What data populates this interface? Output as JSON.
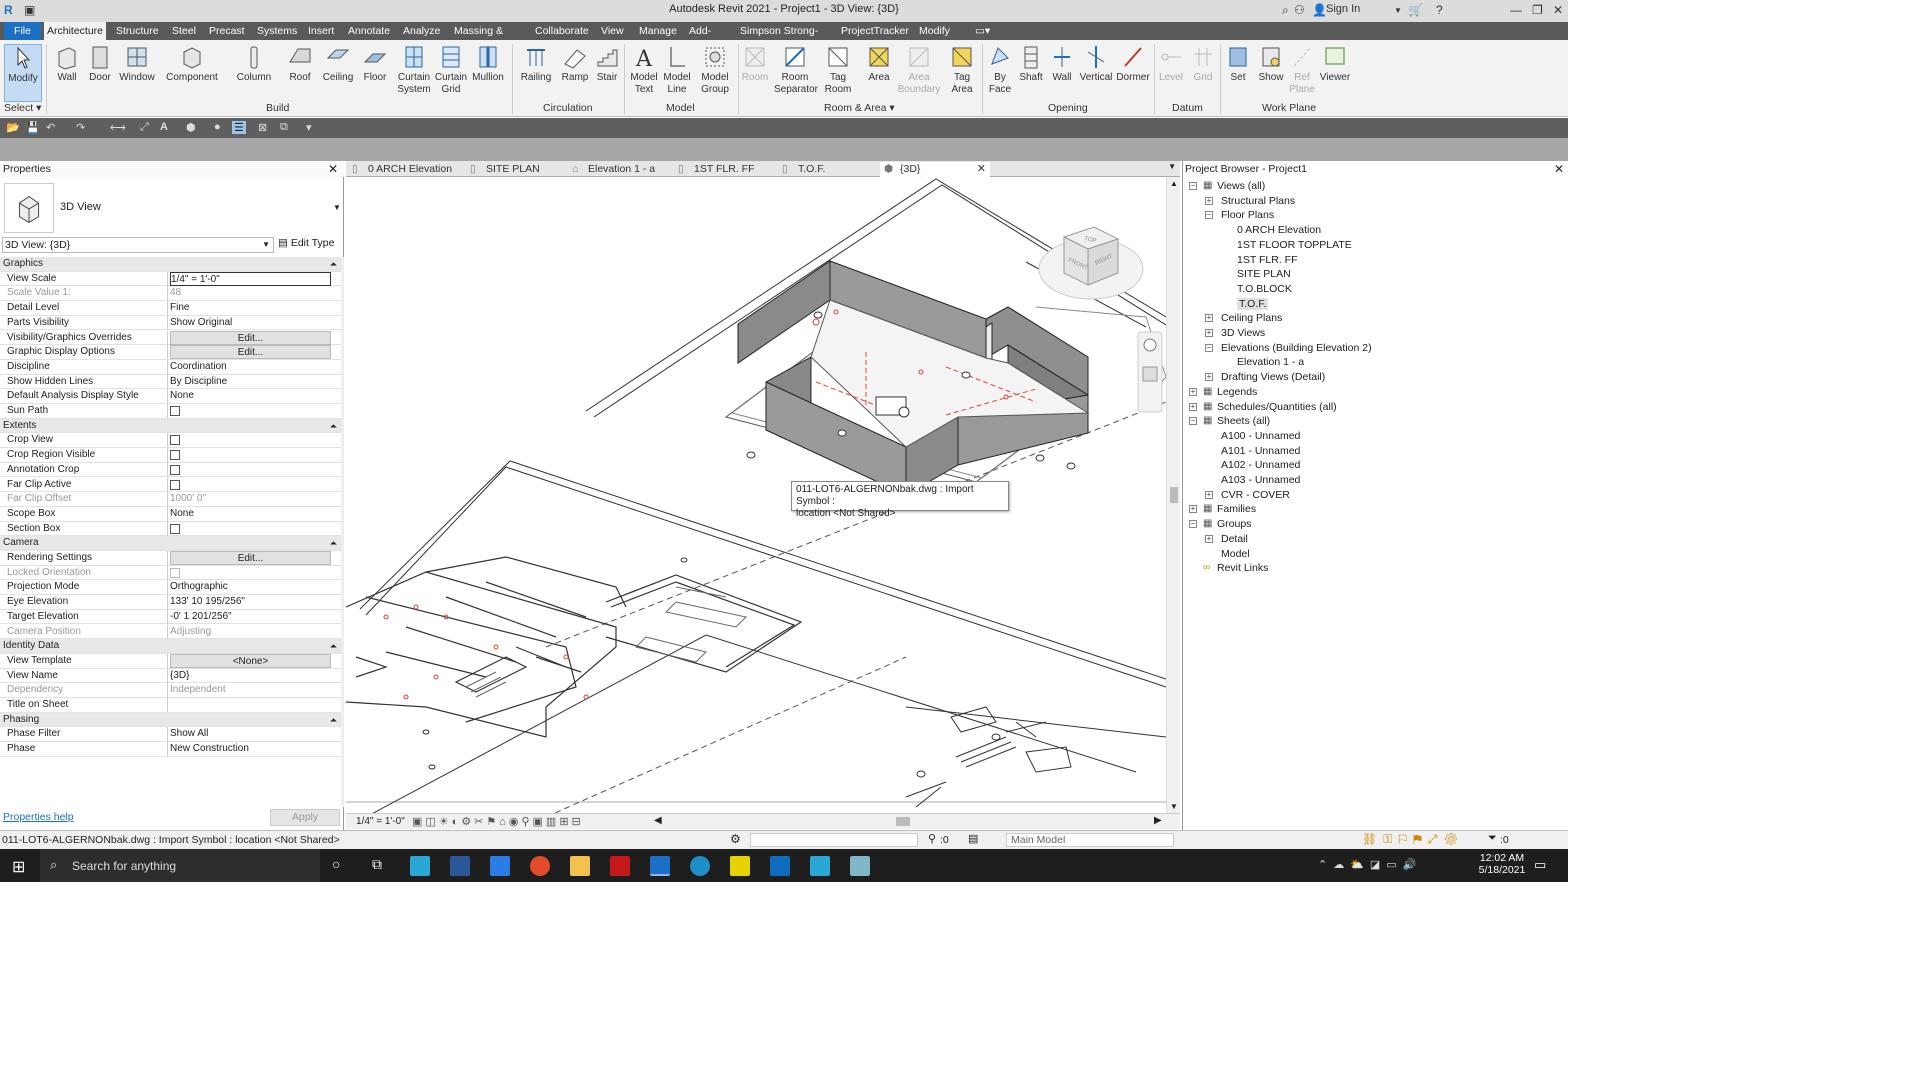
{
  "app": {
    "title": "Autodesk Revit 2021 - Project1 - 3D View: {3D}",
    "sign_in": "Sign In"
  },
  "ribbon_tabs": [
    "File",
    "Architecture",
    "Structure",
    "Steel",
    "Precast",
    "Systems",
    "Insert",
    "Annotate",
    "Analyze",
    "Massing & Site",
    "Collaborate",
    "View",
    "Manage",
    "Add-Ins",
    "Simpson Strong-Tie",
    "ProjectTracker",
    "Modify"
  ],
  "tools": {
    "modify": "Modify",
    "wall": "Wall",
    "door": "Door",
    "window": "Window",
    "component": "Component",
    "column": "Column",
    "roof": "Roof",
    "ceiling": "Ceiling",
    "floor": "Floor",
    "curtain_system_1": "Curtain",
    "curtain_system_2": "System",
    "curtain_grid_1": "Curtain",
    "curtain_grid_2": "Grid",
    "mullion": "Mullion",
    "railing": "Railing",
    "ramp": "Ramp",
    "stair": "Stair",
    "model_text_1": "Model",
    "model_text_2": "Text",
    "model_line_1": "Model",
    "model_line_2": "Line",
    "model_group_1": "Model",
    "model_group_2": "Group",
    "room": "Room",
    "room_sep_1": "Room",
    "room_sep_2": "Separator",
    "tag_room_1": "Tag",
    "tag_room_2": "Room",
    "area": "Area",
    "area_boundary_1": "Area",
    "area_boundary_2": "Boundary",
    "tag_area_1": "Tag",
    "tag_area_2": "Area",
    "by_face_1": "By",
    "by_face_2": "Face",
    "shaft": "Shaft",
    "op_wall": "Wall",
    "vertical": "Vertical",
    "dormer": "Dormer",
    "level": "Level",
    "grid": "Grid",
    "set": "Set",
    "show": "Show",
    "ref_plane_1": "Ref",
    "ref_plane_2": "Plane",
    "viewer": "Viewer"
  },
  "groups": {
    "select": "Select",
    "build": "Build",
    "circulation": "Circulation",
    "model": "Model",
    "room_area": "Room & Area",
    "opening": "Opening",
    "datum": "Datum",
    "work_plane": "Work Plane"
  },
  "properties": {
    "title": "Properties",
    "type_name": "3D View",
    "view_selector": "3D View: {3D}",
    "edit_type": "Edit Type",
    "rows": [
      {
        "k": "Graphics",
        "sec": true
      },
      {
        "k": "View Scale",
        "v": "1/4\" = 1'-0\"",
        "input": true
      },
      {
        "k": "Scale Value    1:",
        "v": "48",
        "gray": true
      },
      {
        "k": "Detail Level",
        "v": "Fine"
      },
      {
        "k": "Parts Visibility",
        "v": "Show Original"
      },
      {
        "k": "Visibility/Graphics Overrides",
        "v": "Edit...",
        "btn": true
      },
      {
        "k": "Graphic Display Options",
        "v": "Edit...",
        "btn": true
      },
      {
        "k": "Discipline",
        "v": "Coordination"
      },
      {
        "k": "Show Hidden Lines",
        "v": "By Discipline"
      },
      {
        "k": "Default Analysis Display Style",
        "v": "None"
      },
      {
        "k": "Sun Path",
        "cb": true
      },
      {
        "k": "Extents",
        "sec": true
      },
      {
        "k": "Crop View",
        "cb": true
      },
      {
        "k": "Crop Region Visible",
        "cb": true
      },
      {
        "k": "Annotation Crop",
        "cb": true
      },
      {
        "k": "Far Clip Active",
        "cb": true
      },
      {
        "k": "Far Clip Offset",
        "v": "1000'  0\"",
        "gray": true
      },
      {
        "k": "Scope Box",
        "v": "None"
      },
      {
        "k": "Section Box",
        "cb": true
      },
      {
        "k": "Camera",
        "sec": true
      },
      {
        "k": "Rendering Settings",
        "v": "Edit...",
        "btn": true
      },
      {
        "k": "Locked Orientation",
        "cb": true,
        "gray": true
      },
      {
        "k": "Projection Mode",
        "v": "Orthographic"
      },
      {
        "k": "Eye Elevation",
        "v": "133'  10 195/256\""
      },
      {
        "k": "Target Elevation",
        "v": "-0'  1 201/256\""
      },
      {
        "k": "Camera Position",
        "v": "Adjusting",
        "gray": true
      },
      {
        "k": "Identity Data",
        "sec": true
      },
      {
        "k": "View Template",
        "v": "<None>",
        "btn": true
      },
      {
        "k": "View Name",
        "v": "{3D}"
      },
      {
        "k": "Dependency",
        "v": "Independent",
        "gray": true
      },
      {
        "k": "Title on Sheet",
        "v": ""
      },
      {
        "k": "Phasing",
        "sec": true
      },
      {
        "k": "Phase Filter",
        "v": "Show All"
      },
      {
        "k": "Phase",
        "v": "New Construction"
      }
    ],
    "help": "Properties help",
    "apply": "Apply"
  },
  "view_tabs": [
    "0 ARCH Elevation",
    "SITE PLAN",
    "Elevation 1 - a",
    "1ST FLR. FF",
    "T.O.F.",
    "{3D}"
  ],
  "viewcube": {
    "top": "TOP",
    "front": "FRONT",
    "right": "RIGHT"
  },
  "tooltip": {
    "line1": "011-LOT6-ALGERNONbak.dwg : Import Symbol :",
    "line2": "location <Not Shared>"
  },
  "view_scale": "1/4\" = 1'-0\"",
  "browser": {
    "title": "Project Browser - Project1",
    "items": [
      {
        "t": "Views (all)",
        "lvl": 0,
        "exp": "-"
      },
      {
        "t": "Structural Plans",
        "lvl": 1,
        "exp": "+"
      },
      {
        "t": "Floor Plans",
        "lvl": 1,
        "exp": "-"
      },
      {
        "t": "0 ARCH Elevation",
        "lvl": 2
      },
      {
        "t": "1ST FLOOR TOPPLATE",
        "lvl": 2
      },
      {
        "t": "1ST FLR. FF",
        "lvl": 2
      },
      {
        "t": "SITE PLAN",
        "lvl": 2
      },
      {
        "t": "T.O.BLOCK",
        "lvl": 2
      },
      {
        "t": "T.O.F.",
        "lvl": 2,
        "sel": true
      },
      {
        "t": "Ceiling Plans",
        "lvl": 1,
        "exp": "+"
      },
      {
        "t": "3D Views",
        "lvl": 1,
        "exp": "+"
      },
      {
        "t": "Elevations (Building Elevation 2)",
        "lvl": 1,
        "exp": "-"
      },
      {
        "t": "Elevation 1 - a",
        "lvl": 2
      },
      {
        "t": "Drafting Views (Detail)",
        "lvl": 1,
        "exp": "+"
      },
      {
        "t": "Legends",
        "lvl": 0,
        "exp": "+"
      },
      {
        "t": "Schedules/Quantities (all)",
        "lvl": 0,
        "exp": "+"
      },
      {
        "t": "Sheets (all)",
        "lvl": 0,
        "exp": "-"
      },
      {
        "t": "A100 - Unnamed",
        "lvl": 1
      },
      {
        "t": "A101 - Unnamed",
        "lvl": 1
      },
      {
        "t": "A102 - Unnamed",
        "lvl": 1
      },
      {
        "t": "A103 - Unnamed",
        "lvl": 1
      },
      {
        "t": "CVR - COVER",
        "lvl": 1,
        "exp": "+"
      },
      {
        "t": "Families",
        "lvl": 0,
        "exp": "+"
      },
      {
        "t": "Groups",
        "lvl": 0,
        "exp": "-"
      },
      {
        "t": "Detail",
        "lvl": 1,
        "exp": "+"
      },
      {
        "t": "Model",
        "lvl": 1
      },
      {
        "t": "Revit Links",
        "lvl": 0
      }
    ]
  },
  "status": {
    "text": "011-LOT6-ALGERNONbak.dwg : Import Symbol : location <Not Shared>",
    "select_count": ":0",
    "workset": "Main Model",
    "filter": ":0"
  },
  "taskbar": {
    "search": "Search for anything",
    "time": "12:02 AM",
    "date": "5/18/2021"
  }
}
